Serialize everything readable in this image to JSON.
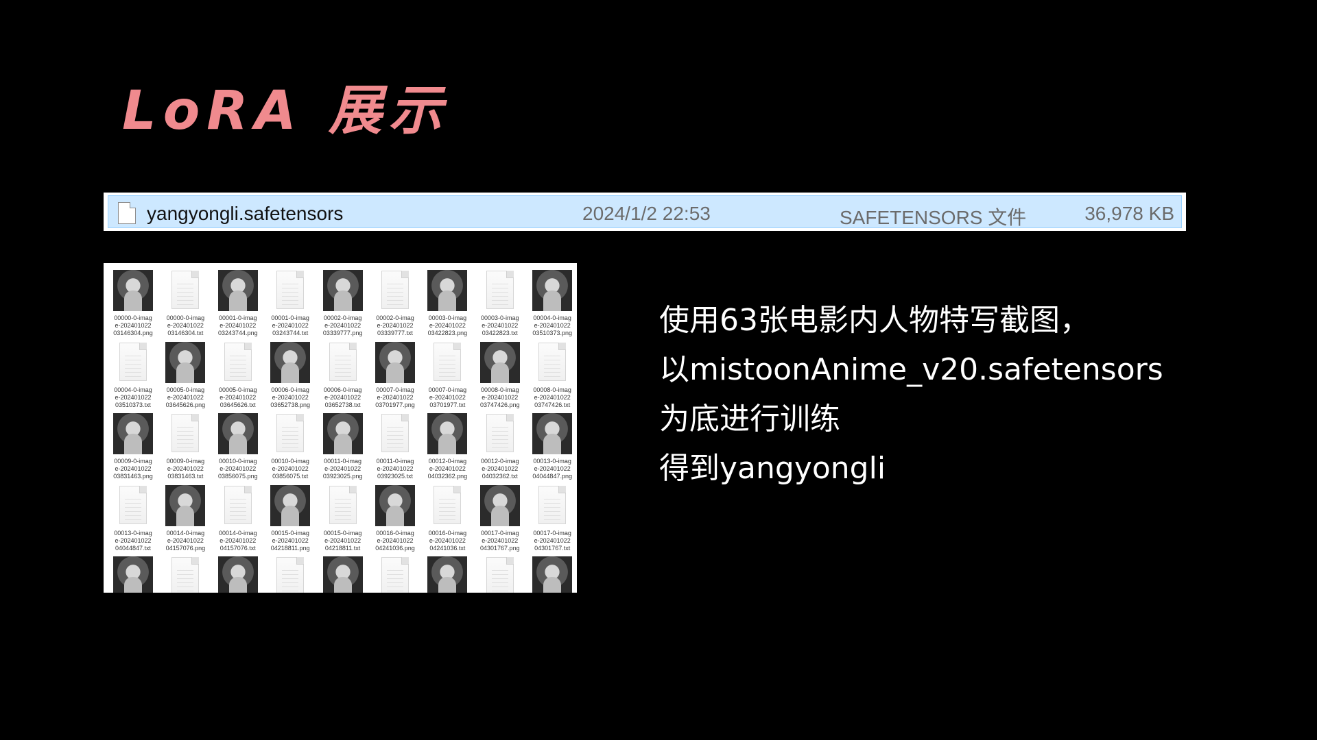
{
  "title": "LoRA 展示",
  "file_row": {
    "icon": "file-icon",
    "name": "yangyongli.safetensors",
    "date": "2024/1/2 22:53",
    "type": "SAFETENSORS 文件",
    "size": "36,978 KB"
  },
  "file_grid": {
    "tiles": [
      {
        "kind": "image",
        "label": "00000-0-imag\ne-202401022\n03146304.png"
      },
      {
        "kind": "text",
        "label": "00000-0-imag\ne-202401022\n03146304.txt"
      },
      {
        "kind": "image",
        "label": "00001-0-imag\ne-202401022\n03243744.png"
      },
      {
        "kind": "text",
        "label": "00001-0-imag\ne-202401022\n03243744.txt"
      },
      {
        "kind": "image",
        "label": "00002-0-imag\ne-202401022\n03339777.png"
      },
      {
        "kind": "text",
        "label": "00002-0-imag\ne-202401022\n03339777.txt"
      },
      {
        "kind": "image",
        "label": "00003-0-imag\ne-202401022\n03422823.png"
      },
      {
        "kind": "text",
        "label": "00003-0-imag\ne-202401022\n03422823.txt"
      },
      {
        "kind": "image",
        "label": "00004-0-imag\ne-202401022\n03510373.png"
      },
      {
        "kind": "text",
        "label": "00004-0-imag\ne-202401022\n03510373.txt"
      },
      {
        "kind": "image",
        "label": "00005-0-imag\ne-202401022\n03645626.png"
      },
      {
        "kind": "text",
        "label": "00005-0-imag\ne-202401022\n03645626.txt"
      },
      {
        "kind": "image",
        "label": "00006-0-imag\ne-202401022\n03652738.png"
      },
      {
        "kind": "text",
        "label": "00006-0-imag\ne-202401022\n03652738.txt"
      },
      {
        "kind": "image",
        "label": "00007-0-imag\ne-202401022\n03701977.png"
      },
      {
        "kind": "text",
        "label": "00007-0-imag\ne-202401022\n03701977.txt"
      },
      {
        "kind": "image",
        "label": "00008-0-imag\ne-202401022\n03747426.png"
      },
      {
        "kind": "text",
        "label": "00008-0-imag\ne-202401022\n03747426.txt"
      },
      {
        "kind": "image",
        "label": "00009-0-imag\ne-202401022\n03831463.png"
      },
      {
        "kind": "text",
        "label": "00009-0-imag\ne-202401022\n03831463.txt"
      },
      {
        "kind": "image",
        "label": "00010-0-imag\ne-202401022\n03856075.png"
      },
      {
        "kind": "text",
        "label": "00010-0-imag\ne-202401022\n03856075.txt"
      },
      {
        "kind": "image",
        "label": "00011-0-imag\ne-202401022\n03923025.png"
      },
      {
        "kind": "text",
        "label": "00011-0-imag\ne-202401022\n03923025.txt"
      },
      {
        "kind": "image",
        "label": "00012-0-imag\ne-202401022\n04032362.png"
      },
      {
        "kind": "text",
        "label": "00012-0-imag\ne-202401022\n04032362.txt"
      },
      {
        "kind": "image",
        "label": "00013-0-imag\ne-202401022\n04044847.png"
      },
      {
        "kind": "text",
        "label": "00013-0-imag\ne-202401022\n04044847.txt"
      },
      {
        "kind": "image",
        "label": "00014-0-imag\ne-202401022\n04157076.png"
      },
      {
        "kind": "text",
        "label": "00014-0-imag\ne-202401022\n04157076.txt"
      },
      {
        "kind": "image",
        "label": "00015-0-imag\ne-202401022\n04218811.png"
      },
      {
        "kind": "text",
        "label": "00015-0-imag\ne-202401022\n04218811.txt"
      },
      {
        "kind": "image",
        "label": "00016-0-imag\ne-202401022\n04241036.png"
      },
      {
        "kind": "text",
        "label": "00016-0-imag\ne-202401022\n04241036.txt"
      },
      {
        "kind": "image",
        "label": "00017-0-imag\ne-202401022\n04301767.png"
      },
      {
        "kind": "text",
        "label": "00017-0-imag\ne-202401022\n04301767.txt"
      },
      {
        "kind": "image",
        "label": ""
      },
      {
        "kind": "text",
        "label": ""
      },
      {
        "kind": "image",
        "label": ""
      },
      {
        "kind": "text",
        "label": ""
      },
      {
        "kind": "image",
        "label": ""
      },
      {
        "kind": "text",
        "label": ""
      },
      {
        "kind": "image",
        "label": ""
      },
      {
        "kind": "text",
        "label": ""
      },
      {
        "kind": "image",
        "label": ""
      }
    ]
  },
  "description": {
    "lines": [
      "使用63张电影内人物特写截图，",
      "以mistoonAnime_v20.safetensors",
      "为底进行训练",
      "得到yangyongli"
    ]
  }
}
